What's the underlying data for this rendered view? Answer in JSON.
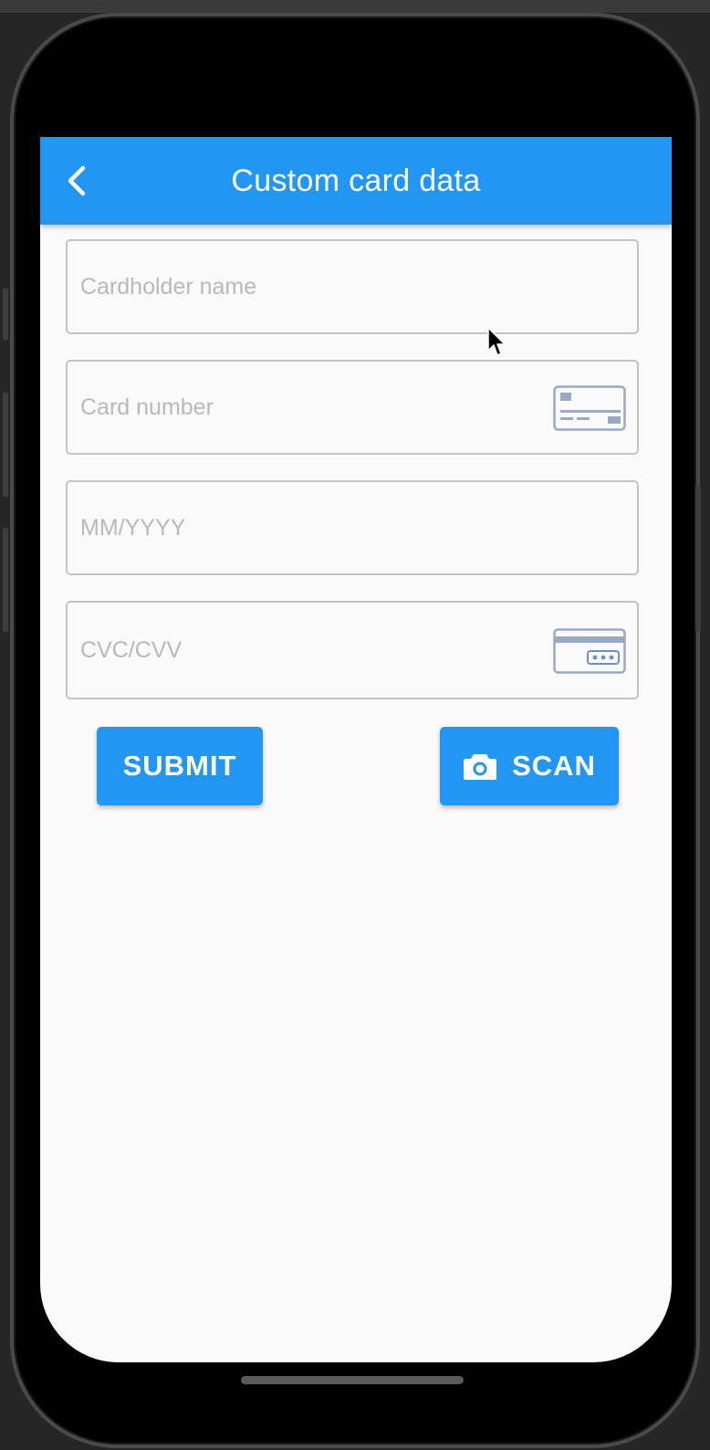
{
  "appbar": {
    "title": "Custom card data"
  },
  "form": {
    "cardholder_placeholder": "Cardholder name",
    "card_number_placeholder": "Card number",
    "expiry_placeholder": "MM/YYYY",
    "cvc_placeholder": "CVC/CVV"
  },
  "buttons": {
    "submit_label": "SUBMIT",
    "scan_label": "SCAN"
  },
  "icons": {
    "back": "chevron-left-icon",
    "card_front": "credit-card-front-icon",
    "card_back": "credit-card-cvc-icon",
    "camera": "camera-icon"
  },
  "colors": {
    "primary": "#2196f3",
    "background": "#fafafa",
    "field_border": "#c4c4c4",
    "placeholder": "#b9b9b9",
    "card_icon": "#9aa9c2"
  }
}
